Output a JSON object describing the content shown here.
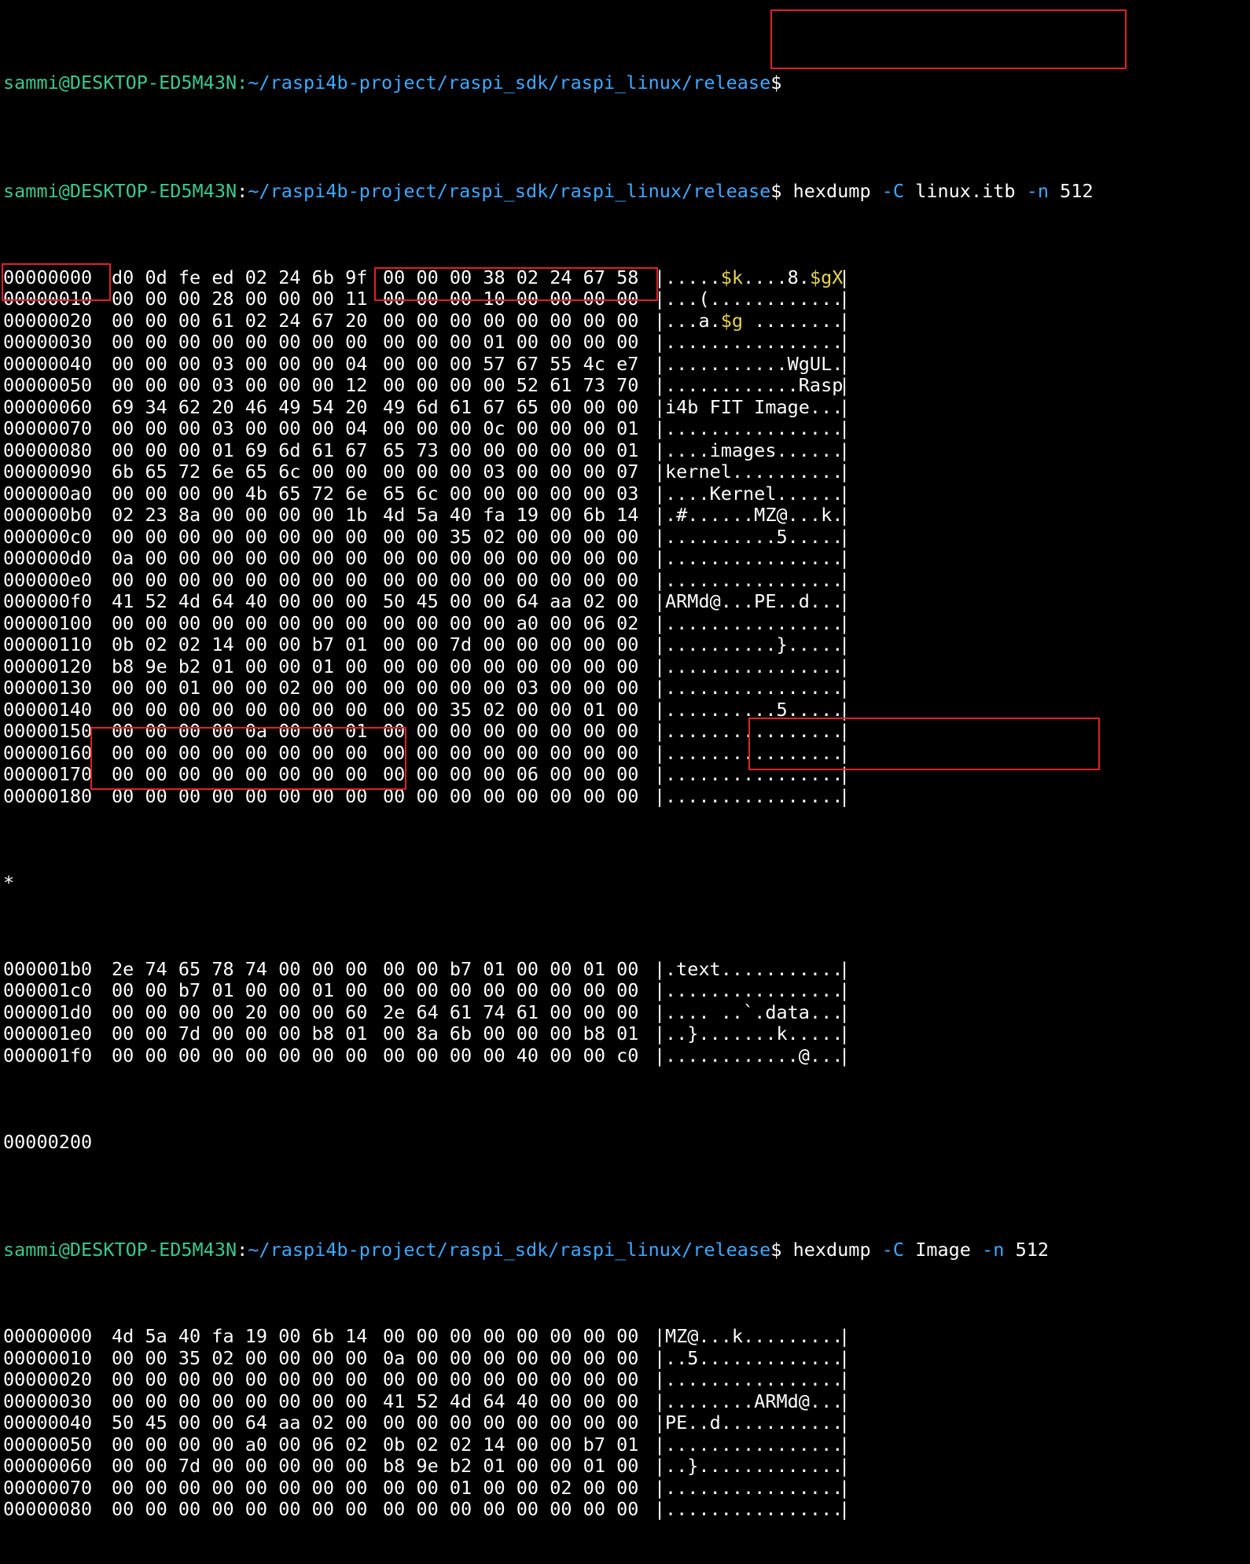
{
  "colors": {
    "background": "#000000",
    "text": "#ffffff",
    "prompt_user": "#3bc88f",
    "prompt_path": "#3ea9ff",
    "flag": "#3ea9ff",
    "ascii_highlight": "#e8d44d",
    "annotation_box": "#e0202a"
  },
  "prompt": {
    "user_host": "sammi@DESKTOP-ED5M43N",
    "path": "~/raspi4b-project/raspi_sdk/raspi_linux/release",
    "symbol": "$"
  },
  "top_prompt_fragment": {
    "user_host": "sammi@DESKTOP-ED5M43N:",
    "path": "~/raspi4b-project/raspi_sdk/raspi_linux/release",
    "symbol": "$"
  },
  "commands": [
    {
      "program": "hexdump",
      "flag1": "-C",
      "file": "linux.itb",
      "flag2": "-n",
      "count": "512"
    },
    {
      "program": "hexdump",
      "flag1": "-C",
      "file": "Image",
      "flag2": "-n",
      "count": "512"
    }
  ],
  "dump1": [
    {
      "offset": "00000000",
      "hex1": "d0 0d fe ed 02 24 6b 9f",
      "hex2": "00 00 00 38 02 24 67 58",
      "ascii_pre": ".....",
      "ascii_y1": "$k",
      "ascii_mid": "....8.",
      "ascii_y2": "$gX",
      "ascii_post": ""
    },
    {
      "offset": "00000010",
      "hex1": "00 00 00 28 00 00 00 11",
      "hex2": "00 00 00 10 00 00 00 00",
      "ascii": "...(............"
    },
    {
      "offset": "00000020",
      "hex1": "00 00 00 61 02 24 67 20",
      "hex2": "00 00 00 00 00 00 00 00",
      "ascii_pre": "...a.",
      "ascii_y1": "$g",
      "ascii_mid": " ........",
      "ascii_y2": "",
      "ascii_post": ""
    },
    {
      "offset": "00000030",
      "hex1": "00 00 00 00 00 00 00 00",
      "hex2": "00 00 00 01 00 00 00 00",
      "ascii": "................"
    },
    {
      "offset": "00000040",
      "hex1": "00 00 00 03 00 00 00 04",
      "hex2": "00 00 00 57 67 55 4c e7",
      "ascii": "...........WgUL."
    },
    {
      "offset": "00000050",
      "hex1": "00 00 00 03 00 00 00 12",
      "hex2": "00 00 00 00 52 61 73 70",
      "ascii": "............Rasp"
    },
    {
      "offset": "00000060",
      "hex1": "69 34 62 20 46 49 54 20",
      "hex2": "49 6d 61 67 65 00 00 00",
      "ascii": "i4b FIT Image..."
    },
    {
      "offset": "00000070",
      "hex1": "00 00 00 03 00 00 00 04",
      "hex2": "00 00 00 0c 00 00 00 01",
      "ascii": "................"
    },
    {
      "offset": "00000080",
      "hex1": "00 00 00 01 69 6d 61 67",
      "hex2": "65 73 00 00 00 00 00 01",
      "ascii": "....images......"
    },
    {
      "offset": "00000090",
      "hex1": "6b 65 72 6e 65 6c 00 00",
      "hex2": "00 00 00 03 00 00 00 07",
      "ascii": "kernel.........."
    },
    {
      "offset": "000000a0",
      "hex1": "00 00 00 00 4b 65 72 6e",
      "hex2": "65 6c 00 00 00 00 00 03",
      "ascii": "....Kernel......"
    },
    {
      "offset": "000000b0",
      "hex1": "02 23 8a 00 00 00 00 1b",
      "hex2": "4d 5a 40 fa 19 00 6b 14",
      "ascii": ".#......MZ@...k."
    },
    {
      "offset": "000000c0",
      "hex1": "00 00 00 00 00 00 00 00",
      "hex2": "00 00 35 02 00 00 00 00",
      "ascii": "..........5....."
    },
    {
      "offset": "000000d0",
      "hex1": "0a 00 00 00 00 00 00 00",
      "hex2": "00 00 00 00 00 00 00 00",
      "ascii": "................"
    },
    {
      "offset": "000000e0",
      "hex1": "00 00 00 00 00 00 00 00",
      "hex2": "00 00 00 00 00 00 00 00",
      "ascii": "................"
    },
    {
      "offset": "000000f0",
      "hex1": "41 52 4d 64 40 00 00 00",
      "hex2": "50 45 00 00 64 aa 02 00",
      "ascii": "ARMd@...PE..d..."
    },
    {
      "offset": "00000100",
      "hex1": "00 00 00 00 00 00 00 00",
      "hex2": "00 00 00 00 a0 00 06 02",
      "ascii": "................"
    },
    {
      "offset": "00000110",
      "hex1": "0b 02 02 14 00 00 b7 01",
      "hex2": "00 00 7d 00 00 00 00 00",
      "ascii": "..........}....."
    },
    {
      "offset": "00000120",
      "hex1": "b8 9e b2 01 00 00 01 00",
      "hex2": "00 00 00 00 00 00 00 00",
      "ascii": "................"
    },
    {
      "offset": "00000130",
      "hex1": "00 00 01 00 00 02 00 00",
      "hex2": "00 00 00 00 03 00 00 00",
      "ascii": "................"
    },
    {
      "offset": "00000140",
      "hex1": "00 00 00 00 00 00 00 00",
      "hex2": "00 00 35 02 00 00 01 00",
      "ascii": "..........5....."
    },
    {
      "offset": "00000150",
      "hex1": "00 00 00 00 0a 00 00 01",
      "hex2": "00 00 00 00 00 00 00 00",
      "ascii": "................"
    },
    {
      "offset": "00000160",
      "hex1": "00 00 00 00 00 00 00 00",
      "hex2": "00 00 00 00 00 00 00 00",
      "ascii": "................"
    },
    {
      "offset": "00000170",
      "hex1": "00 00 00 00 00 00 00 00",
      "hex2": "00 00 00 00 06 00 00 00",
      "ascii": "................"
    },
    {
      "offset": "00000180",
      "hex1": "00 00 00 00 00 00 00 00",
      "hex2": "00 00 00 00 00 00 00 00",
      "ascii": "................"
    }
  ],
  "repeat_marker": "*",
  "dump1_tail": [
    {
      "offset": "000001b0",
      "hex1": "2e 74 65 78 74 00 00 00",
      "hex2": "00 00 b7 01 00 00 01 00",
      "ascii": ".text..........."
    },
    {
      "offset": "000001c0",
      "hex1": "00 00 b7 01 00 00 01 00",
      "hex2": "00 00 00 00 00 00 00 00",
      "ascii": "................"
    },
    {
      "offset": "000001d0",
      "hex1": "00 00 00 00 20 00 00 60",
      "hex2": "2e 64 61 74 61 00 00 00",
      "ascii": ".... ..`.data..."
    },
    {
      "offset": "000001e0",
      "hex1": "00 00 7d 00 00 00 b8 01",
      "hex2": "00 8a 6b 00 00 00 b8 01",
      "ascii": "..}.......k....."
    },
    {
      "offset": "000001f0",
      "hex1": "00 00 00 00 00 00 00 00",
      "hex2": "00 00 00 00 40 00 00 c0",
      "ascii": "............@..."
    }
  ],
  "end_offset": "00000200",
  "dump2": [
    {
      "offset": "00000000",
      "hex1": "4d 5a 40 fa 19 00 6b 14",
      "hex2": "00 00 00 00 00 00 00 00",
      "ascii": "MZ@...k........."
    },
    {
      "offset": "00000010",
      "hex1": "00 00 35 02 00 00 00 00",
      "hex2": "0a 00 00 00 00 00 00 00",
      "ascii": "..5............."
    },
    {
      "offset": "00000020",
      "hex1": "00 00 00 00 00 00 00 00",
      "hex2": "00 00 00 00 00 00 00 00",
      "ascii": "................"
    },
    {
      "offset": "00000030",
      "hex1": "00 00 00 00 00 00 00 00",
      "hex2": "41 52 4d 64 40 00 00 00",
      "ascii": "........ARMd@..."
    },
    {
      "offset": "00000040",
      "hex1": "50 45 00 00 64 aa 02 00",
      "hex2": "00 00 00 00 00 00 00 00",
      "ascii": "PE..d..........."
    },
    {
      "offset": "00000050",
      "hex1": "00 00 00 00 a0 00 06 02",
      "hex2": "0b 02 02 14 00 00 b7 01",
      "ascii": "................"
    },
    {
      "offset": "00000060",
      "hex1": "00 00 7d 00 00 00 00 00",
      "hex2": "b8 9e b2 01 00 00 01 00",
      "ascii": "..}............."
    },
    {
      "offset": "00000070",
      "hex1": "00 00 00 00 00 00 00 00",
      "hex2": "00 00 01 00 00 02 00 00",
      "ascii": "................"
    },
    {
      "offset": "00000080",
      "hex1": "00 00 00 00 00 00 00 00",
      "hex2": "00 00 00 00 00 00 00 00",
      "ascii": "................"
    }
  ]
}
